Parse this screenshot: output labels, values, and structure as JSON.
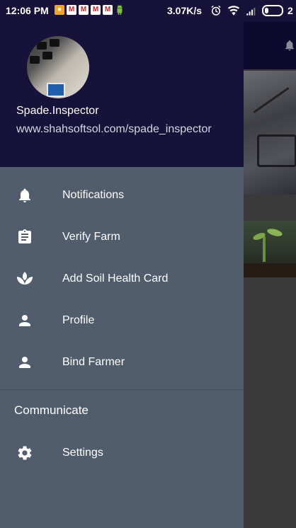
{
  "status_bar": {
    "time": "12:06 PM",
    "speed": "3.07K/s",
    "battery": "2"
  },
  "drawer": {
    "user_name": "Spade.Inspector",
    "user_url": "www.shahsoftsol.com/spade_inspector",
    "menu_items": [
      {
        "label": "Notifications",
        "icon": "bell-icon"
      },
      {
        "label": "Verify Farm",
        "icon": "clipboard-icon"
      },
      {
        "label": "Add Soil Health Card",
        "icon": "sprout-icon"
      },
      {
        "label": "Profile",
        "icon": "person-icon"
      },
      {
        "label": "Bind Farmer",
        "icon": "person-icon"
      }
    ],
    "section_header": "Communicate",
    "settings_label": "Settings",
    "settings_icon": "gear-icon"
  },
  "colors": {
    "header_bg": "#16123a",
    "drawer_bg": "#515c6d",
    "text": "#ffffff"
  }
}
